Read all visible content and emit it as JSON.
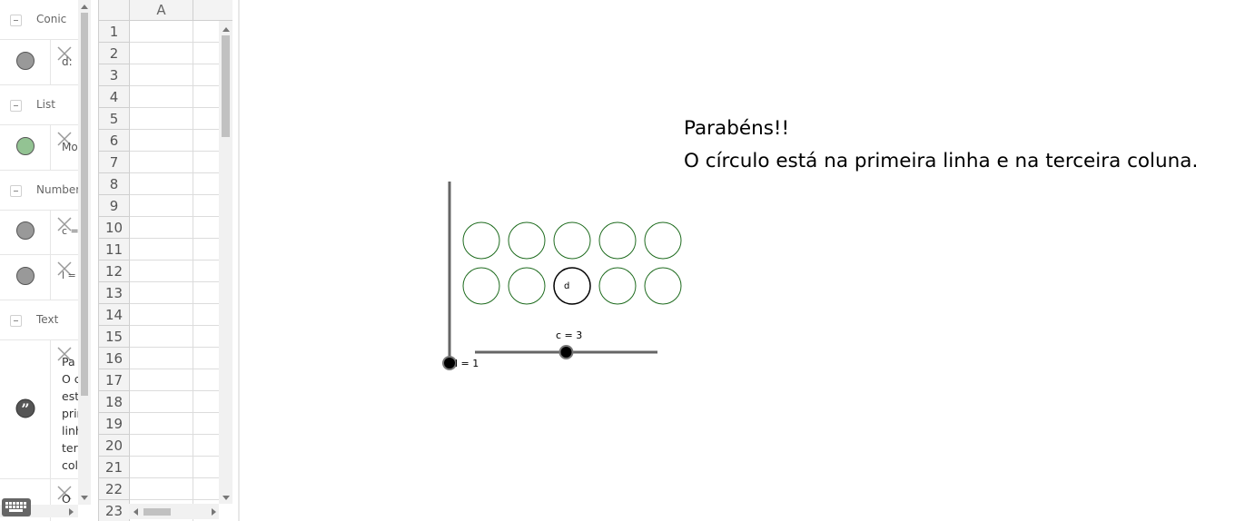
{
  "algebra": {
    "groups": [
      {
        "label": "Conic"
      },
      {
        "label": "List"
      },
      {
        "label": "Number"
      },
      {
        "label": "Text"
      }
    ],
    "rows": [
      {
        "text": "d:",
        "marble_color": "#999999"
      },
      {
        "text": "Mo",
        "marble_color": "#93c393"
      },
      {
        "text": "c =",
        "marble_color": "#999999"
      },
      {
        "text": "l =",
        "marble_color": "#999999"
      },
      {
        "text": "Pa\nO c\nest\nprin\nlinh\nter\ncol",
        "marble_icon": "quote-icon"
      },
      {
        "text": "O"
      }
    ]
  },
  "spreadsheet": {
    "column_headers": [
      "A"
    ],
    "row_numbers": [
      "1",
      "2",
      "3",
      "4",
      "5",
      "6",
      "7",
      "8",
      "9",
      "10",
      "11",
      "12",
      "13",
      "14",
      "15",
      "16",
      "17",
      "18",
      "19",
      "20",
      "21",
      "22",
      "23"
    ]
  },
  "graphics": {
    "message_line1": "Parabéns!!",
    "message_line2": "O círculo está na primeira linha e na terceira coluna.",
    "slider_c": {
      "label": "c = 3",
      "value": 3,
      "min": 1,
      "max": 5
    },
    "slider_l": {
      "label": "l = 1",
      "value": 1,
      "min": 1,
      "max": 5
    },
    "selected_circle_label": "d",
    "grid": {
      "rows": 2,
      "columns": 5,
      "circle_color": "#1e6b1e",
      "selected_color": "#000000"
    }
  }
}
